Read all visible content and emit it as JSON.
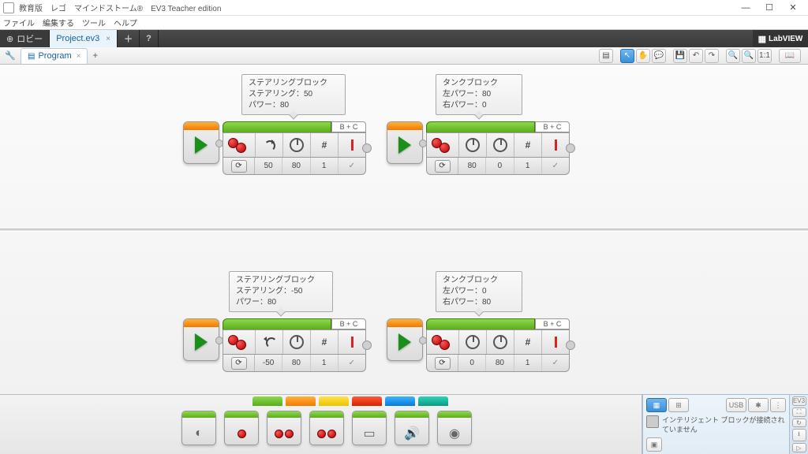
{
  "window": {
    "title": "教育版　レゴ　マインドストーム®　EV3 Teacher edition",
    "minimize": "—",
    "maximize": "☐",
    "close": "✕"
  },
  "menu": {
    "file": "ファイル",
    "edit": "編集する",
    "tools": "ツール",
    "help": "ヘルプ"
  },
  "tabs": {
    "lobby": "ロビー",
    "project": "Project.ev3",
    "add": "＋",
    "help": "?",
    "labview": "LabVIEW"
  },
  "subtabs": {
    "program": "Program",
    "add": "+"
  },
  "toolbar": {
    "doc": "▤",
    "cursor": "↖",
    "hand": "✋",
    "comment": "💬",
    "save": "💾",
    "undo": "↶",
    "redo": "↷",
    "zoomout": "🔍",
    "zoomin": "🔍",
    "fit": "1:1",
    "book": "📖"
  },
  "comments": {
    "c1": {
      "l1": "ステアリングブロック",
      "l2": "ステアリング：50",
      "l3": "パワー：80"
    },
    "c2": {
      "l1": "タンクブロック",
      "l2": "左パワー：80",
      "l3": "右パワー：0"
    },
    "c3": {
      "l1": "ステアリングブロック",
      "l2": "ステアリング：-50",
      "l3": "パワー：80"
    },
    "c4": {
      "l1": "タンクブロック",
      "l2": "左パワー：0",
      "l3": "右パワー：80"
    }
  },
  "blocks": {
    "port": "B + C",
    "b1": {
      "v1": "50",
      "v2": "80",
      "v3": "1",
      "v4": "✓"
    },
    "b2": {
      "v1": "80",
      "v2": "0",
      "v3": "1",
      "v4": "✓"
    },
    "b3": {
      "v1": "-50",
      "v2": "80",
      "v3": "1",
      "v4": "✓"
    },
    "b4": {
      "v1": "0",
      "v2": "80",
      "v3": "1",
      "v4": "✓"
    },
    "mode": "⟳"
  },
  "status": {
    "ev3": "EV3",
    "usb": "USB",
    "bt": "✱",
    "wifi": "⋮",
    "expand": "⛶",
    "refresh": "↻",
    "down": "⭳",
    "right": "▷",
    "msg": "インテリジェント ブロックが接続されていません"
  }
}
